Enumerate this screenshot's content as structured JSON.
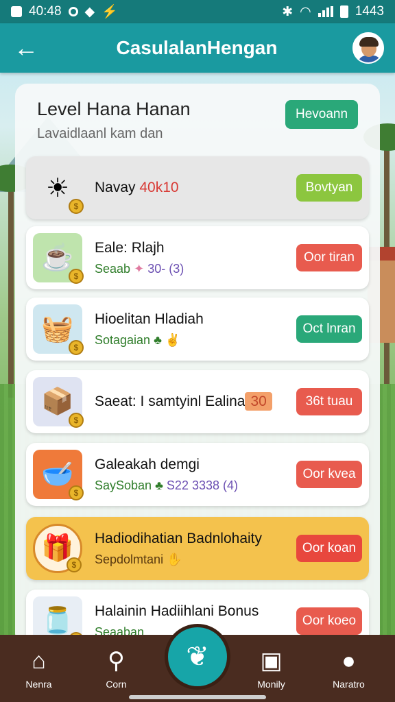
{
  "status_bar": {
    "time": "40:48",
    "right_text": "1443"
  },
  "app_bar": {
    "title": "CasulalanHengan",
    "back_icon": "back-arrow-icon",
    "avatar_icon": "avatar-icon"
  },
  "panel": {
    "title": "Level Hana Hanan",
    "subtitle": "Lavaidlaanl kam dan",
    "header_button": "Hevoann"
  },
  "cards": [
    {
      "icon": "sun-icon",
      "title": "Navay",
      "title_accent": "40k10",
      "button": "Bovtyan",
      "button_color": "#8cc63f"
    },
    {
      "icon": "cup-icon",
      "title": "Eale: Rlajh",
      "sub": "Seaab",
      "sub_extra": "30- (3)",
      "button": "Oor tiran",
      "button_color": "#e85b4e"
    },
    {
      "icon": "basket-icon",
      "title": "Hioelitan Hladiah",
      "sub": "Sotagaian",
      "button": "Oct lnran",
      "button_color": "#2aa879"
    },
    {
      "icon": "box-icon",
      "title": "Saeat: I samtyinl Ealina",
      "title_tag": "30",
      "button": "36t tuau",
      "button_color": "#e85b4e"
    },
    {
      "icon": "bowl-icon",
      "title": "Galeakah demgi",
      "sub": "SaySoban",
      "sub_extra": "S22 3338 (4)",
      "button": "Oor kvea",
      "button_color": "#e85b4e"
    },
    {
      "icon": "gift-basket-icon",
      "title": "Hadiodihatian Badnlohaity",
      "sub": "Sepdolmtani",
      "button": "Oor koan",
      "button_color": "#e8473d"
    },
    {
      "icon": "jar-icon",
      "title": "Halainin Hadiihlani Bonus",
      "sub": "Seaaban",
      "button": "Oor koeo",
      "button_color": "#e85b4e"
    }
  ],
  "bottom_nav": [
    {
      "icon": "home-icon",
      "label": "Nenra"
    },
    {
      "icon": "search-icon",
      "label": "Corn"
    },
    {
      "icon": "center-action-icon",
      "label": ""
    },
    {
      "icon": "profile-card-icon",
      "label": "Monily"
    },
    {
      "icon": "user-icon",
      "label": "Naratro"
    }
  ]
}
